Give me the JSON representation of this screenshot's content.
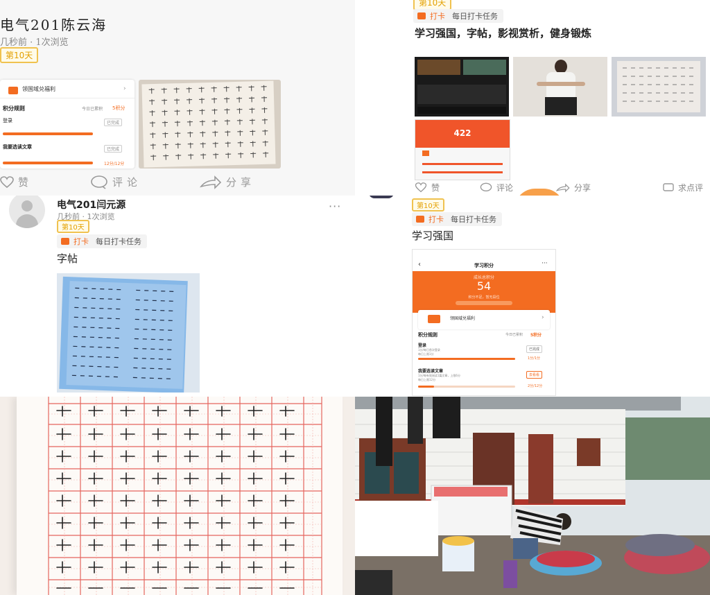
{
  "posts": {
    "tl": {
      "author_title": "电气201陈云海",
      "meta": "几秒前 · 1次浏览",
      "day_badge": "第10天",
      "mini_app": {
        "banner": "领国域兑福利",
        "rules_title": "积分规则",
        "rules_side": "今日已累积",
        "rules_side_value": "5积分",
        "row1_title": "登录",
        "row1_status": "已完成",
        "row2_title": "我要选读文章",
        "row2_status": "12分/12分"
      },
      "actions": {
        "like": "赞",
        "comment": "评论",
        "share": "分享"
      }
    },
    "tr": {
      "day_badge": "第10天",
      "daka_label": "打卡",
      "task_label": "每日打卡任务",
      "content": "学习强国，字帖，影视赏析，健身锻炼",
      "phone_score": "422",
      "actions": {
        "like": "赞",
        "comment": "评论",
        "share": "分享",
        "help": "求点评"
      }
    },
    "ml": {
      "author_title": "电气201闫元源",
      "meta": "几秒前 · 1次浏览",
      "day_badge": "第10天",
      "daka_label": "打卡",
      "task_label": "每日打卡任务",
      "content": "字帖",
      "more": "···"
    },
    "mr": {
      "day_badge": "第10天",
      "daka_label": "打卡",
      "task_label": "每日打卡任务",
      "content": "学习强国",
      "phone": {
        "title": "学习积分",
        "header_sub": "成长总积分",
        "score": "54",
        "header_note": "积分不足，暂无段位",
        "banner": "领国域兑福利",
        "rules_title": "积分规则",
        "rules_side": "今日已累积",
        "rules_side_value": "5积分",
        "row1_title": "登录",
        "row1_desc": "1分/每日首次登录",
        "row1_desc2": "每日上限1分",
        "row1_status": "已完成",
        "row1_score": "1分/1分",
        "row2_title": "我要选读文章",
        "row2_desc": "1分/每有效阅读1篇文章，上限6分",
        "row2_desc2": "每日上限12分",
        "row2_status": "去看看",
        "row2_score": "2分/12分"
      }
    }
  },
  "colors": {
    "accent": "#f36c21",
    "badge": "#f0c24f",
    "grid_red": "#e5655e"
  }
}
